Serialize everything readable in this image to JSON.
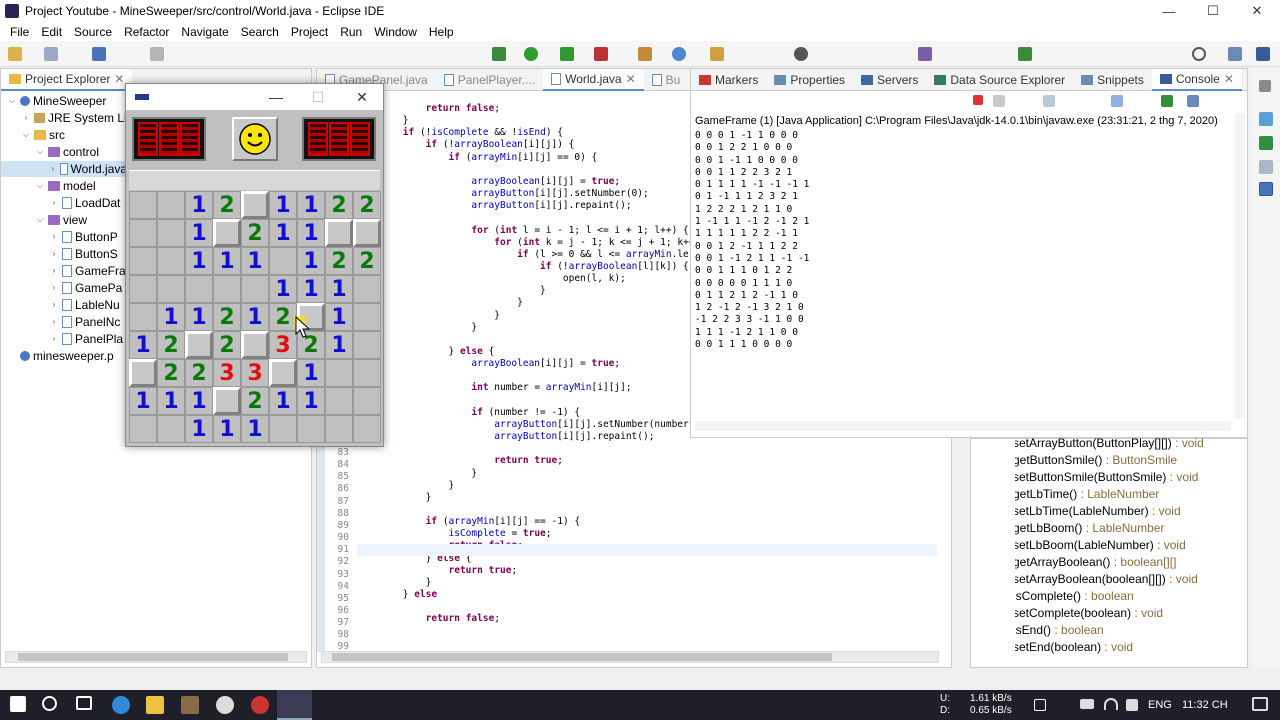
{
  "window": {
    "title": "Project Youtube - MineSweeper/src/control/World.java - Eclipse IDE",
    "min": "—",
    "max": "☐",
    "close": "✕"
  },
  "menu": [
    "File",
    "Edit",
    "Source",
    "Refactor",
    "Navigate",
    "Search",
    "Project",
    "Run",
    "Window",
    "Help"
  ],
  "project_explorer": {
    "tab": "Project Explorer",
    "nodes": [
      {
        "label": "MineSweeper",
        "kind": "prj"
      },
      {
        "label": "JRE System Lib",
        "kind": "lib"
      },
      {
        "label": "src",
        "kind": "folder"
      },
      {
        "label": "control",
        "kind": "pkg"
      },
      {
        "label": "World.java",
        "kind": "jf"
      },
      {
        "label": "model",
        "kind": "pkg"
      },
      {
        "label": "LoadDat",
        "kind": "jf"
      },
      {
        "label": "view",
        "kind": "pkg"
      },
      {
        "label": "ButtonP",
        "kind": "jf"
      },
      {
        "label": "ButtonS",
        "kind": "jf"
      },
      {
        "label": "GameFra",
        "kind": "jf"
      },
      {
        "label": "GamePa",
        "kind": "jf"
      },
      {
        "label": "LableNu",
        "kind": "jf"
      },
      {
        "label": "PanelNc",
        "kind": "jf"
      },
      {
        "label": "PanelPla",
        "kind": "jf"
      },
      {
        "label": "minesweeper.p",
        "kind": "prj"
      }
    ]
  },
  "editor": {
    "tabs": [
      "GamePanel.java",
      "PanelPlayer....",
      "World.java",
      "Bu"
    ],
    "lines_top": [
      "            return false;",
      "        }",
      "        if (!isComplete && !isEnd) {",
      "            if (!arrayBoolean[i][j]) {",
      "                if (arrayMin[i][j] == 0) {",
      "",
      "                    arrayBoolean[i][j] = true;",
      "                    arrayButton[i][j].setNumber(0);",
      "                    arrayButton[i][j].repaint();",
      "",
      "                    for (int l = i - 1; l <= i + 1; l++) {",
      "                        for (int k = j - 1; k <= j + 1; k++",
      "                            if (l >= 0 && l <= arrayMin.ler",
      "                                if (!arrayBoolean[l][k]) {",
      "                                    open(l, k);",
      "                                }",
      "                            }",
      "                        }",
      "                    }",
      "",
      "                } else {",
      "                    arrayBoolean[i][j] = true;",
      "",
      "                    int number = arrayMin[i][j];",
      "",
      "                    if (number != -1) {",
      "                        arrayButton[i][j].setNumber(number);",
      "                        arrayButton[i][j].repaint();",
      "",
      "                        return true;",
      "                    }",
      "                }",
      "            }",
      "",
      "            if (arrayMin[i][j] == -1) {",
      "                isComplete = true;",
      "                return false;",
      "            } else {",
      "                return true;",
      "            }",
      "        } else",
      "",
      "            return false;",
      ""
    ],
    "line_numbers": [
      "83",
      "84",
      "85",
      "86",
      "87",
      "88",
      "89",
      "90",
      "91",
      "92",
      "93",
      "94",
      "95",
      "96",
      "97",
      "98",
      "99"
    ]
  },
  "views": {
    "tabs": [
      "Markers",
      "Properties",
      "Servers",
      "Data Source Explorer",
      "Snippets",
      "Console"
    ],
    "console_header": "GameFrame (1) [Java Application] C:\\Program Files\\Java\\jdk-14.0.1\\bin\\javaw.exe  (23:31:21, 2 thg 7, 2020)",
    "console_lines": [
      "0 0 0 1 -1 1 0 0 0",
      "0 0 1 2 2 1 0 0 0",
      "0 0 1 -1 1 0 0 0 0",
      "0 0 1 1 2 2 3 2 1",
      "0 1 1 1 1 -1 -1 -1 1",
      "0 1 -1 1 1 2 3 2 1",
      "1 2 2 2 1 2 1 1 0",
      "1 -1 1 1 -1 2 -1 2 1",
      "1 1 1 1 1 2 2 -1 1",
      "0 0 1 2 -1 1 1 2 2",
      "0 0 1 -1 2 1 1 -1 -1",
      "0 0 1 1 1 0 1 2 2",
      "0 0 0 0 0 1 1 1 0",
      "0 1 1 2 1 2 -1 1 0",
      "1 2 -1 2 -1 3 2 1 0",
      "-1 2 2 3 3 -1 1 0 0",
      "1 1 1 -1 2 1 1 0 0",
      "0 0 1 1 1 0 0 0 0"
    ]
  },
  "outline": {
    "items": [
      {
        "name": "setArrayButton(ButtonPlay[][])",
        "type": " : void"
      },
      {
        "name": "getButtonSmile()",
        "type": " : ButtonSmile"
      },
      {
        "name": "setButtonSmile(ButtonSmile)",
        "type": " : void"
      },
      {
        "name": "getLbTime()",
        "type": " : LableNumber"
      },
      {
        "name": "setLbTime(LableNumber)",
        "type": " : void"
      },
      {
        "name": "getLbBoom()",
        "type": " : LableNumber"
      },
      {
        "name": "setLbBoom(LableNumber)",
        "type": " : void"
      },
      {
        "name": "getArrayBoolean()",
        "type": " : boolean[][]"
      },
      {
        "name": "setArrayBoolean(boolean[][])",
        "type": " : void"
      },
      {
        "name": "isComplete()",
        "type": " : boolean"
      },
      {
        "name": "setComplete(boolean)",
        "type": " : void"
      },
      {
        "name": "isEnd()",
        "type": " : boolean"
      },
      {
        "name": "setEnd(boolean)",
        "type": " : void"
      }
    ]
  },
  "game": {
    "grid": [
      [
        "",
        "",
        "1",
        "2",
        "#",
        "1",
        "1",
        "2",
        "2"
      ],
      [
        "",
        "",
        "1",
        "#",
        "2",
        "1",
        "1",
        "#",
        "#"
      ],
      [
        "",
        "",
        "1",
        "1",
        "1",
        "",
        "1",
        "2",
        "2"
      ],
      [
        "",
        "",
        "",
        "",
        "",
        "1",
        "1",
        "1",
        ""
      ],
      [
        "",
        "1",
        "1",
        "2",
        "1",
        "2",
        "#",
        "1",
        ""
      ],
      [
        "1",
        "2",
        "#",
        "2",
        "#",
        "3",
        "2",
        "1",
        ""
      ],
      [
        "#",
        "2",
        "2",
        "3",
        "3",
        "#",
        "1",
        "",
        ""
      ],
      [
        "1",
        "1",
        "1",
        "#",
        "2",
        "1",
        "1",
        "",
        ""
      ],
      [
        "",
        "",
        "1",
        "1",
        "1",
        "",
        "",
        "",
        ""
      ]
    ]
  },
  "taskbar": {
    "net_up": "1.61 kB/s",
    "net_down": "0.65 kB/s",
    "u_label": "U:",
    "d_label": "D:",
    "lang": "ENG",
    "time": "11:32 CH"
  }
}
